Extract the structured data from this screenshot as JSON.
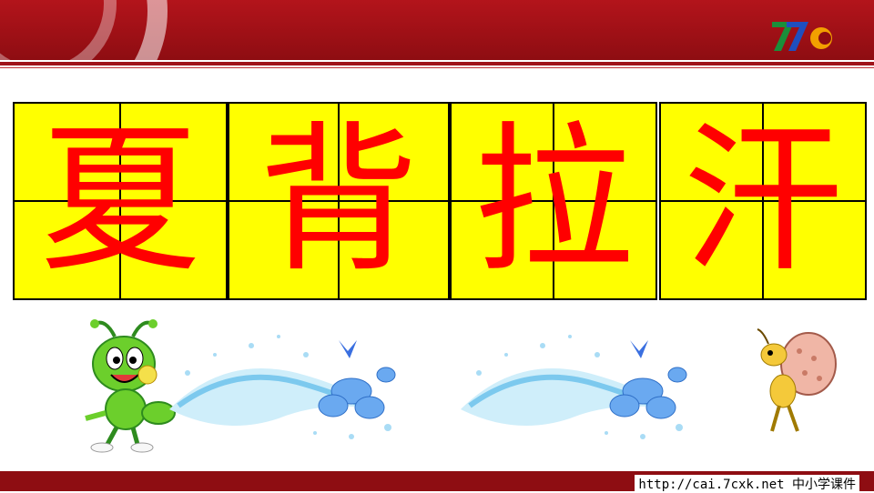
{
  "characters": [
    "夏",
    "背",
    "拉",
    "汗"
  ],
  "footer": {
    "url_text": "http://cai.7cxk.net 中小学课件"
  },
  "logo": {
    "name": "7c-logo-icon"
  },
  "colors": {
    "header": "#8e0d12",
    "card_bg": "#ffff00",
    "char": "#ff0000"
  }
}
